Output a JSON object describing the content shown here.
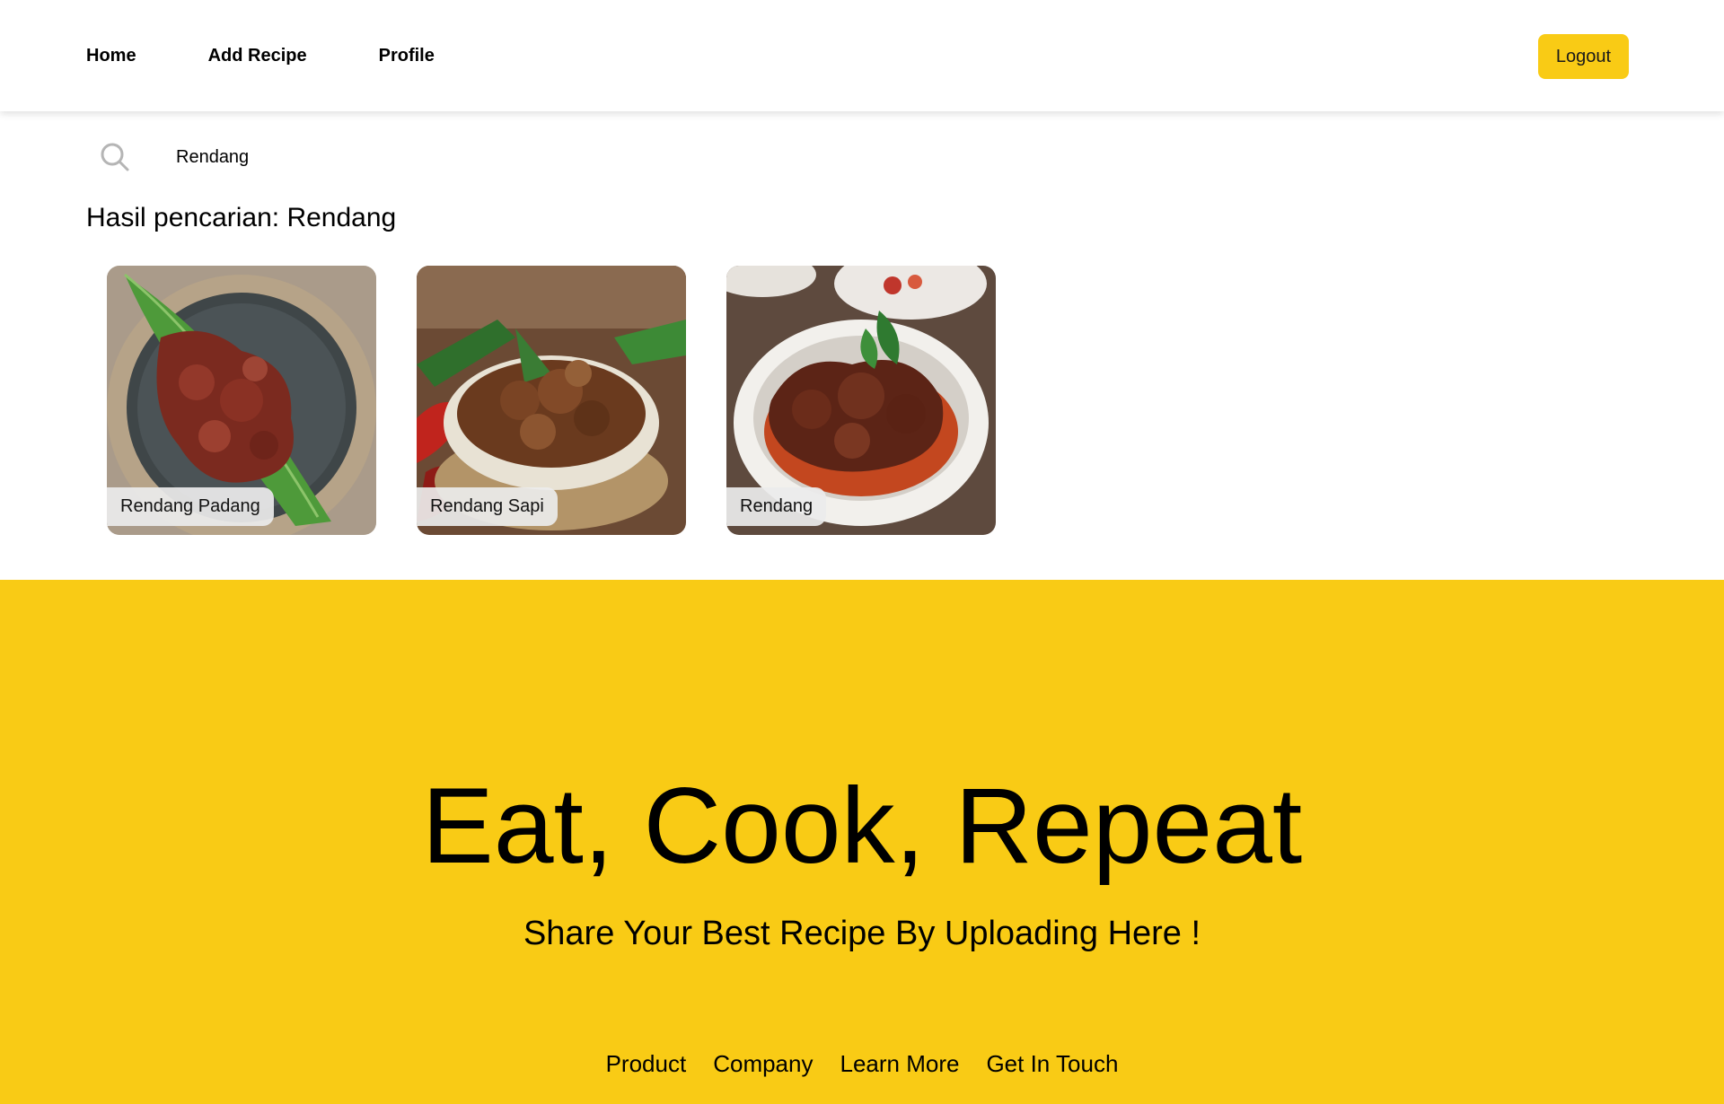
{
  "colors": {
    "accent": "#f9cb15",
    "header_bg": "#ffffff",
    "label_bg": "#ebebeb"
  },
  "nav": {
    "items": [
      {
        "label": "Home"
      },
      {
        "label": "Add Recipe"
      },
      {
        "label": "Profile"
      }
    ],
    "logout_label": "Logout"
  },
  "search": {
    "icon": "search-icon",
    "value": "Rendang",
    "result_title": "Hasil pencarian: Rendang"
  },
  "results": [
    {
      "name": "Rendang Padang",
      "image": "rendang-on-banana-leaf-dark-plate"
    },
    {
      "name": "Rendang Sapi",
      "image": "rendang-in-bowl-with-chilies"
    },
    {
      "name": "Rendang",
      "image": "rendang-in-white-bowl"
    }
  ],
  "footer": {
    "title": "Eat, Cook, Repeat",
    "subtitle": "Share Your Best Recipe By Uploading Here !",
    "links": [
      {
        "label": "Product"
      },
      {
        "label": "Company"
      },
      {
        "label": "Learn More"
      },
      {
        "label": "Get In Touch"
      }
    ]
  }
}
